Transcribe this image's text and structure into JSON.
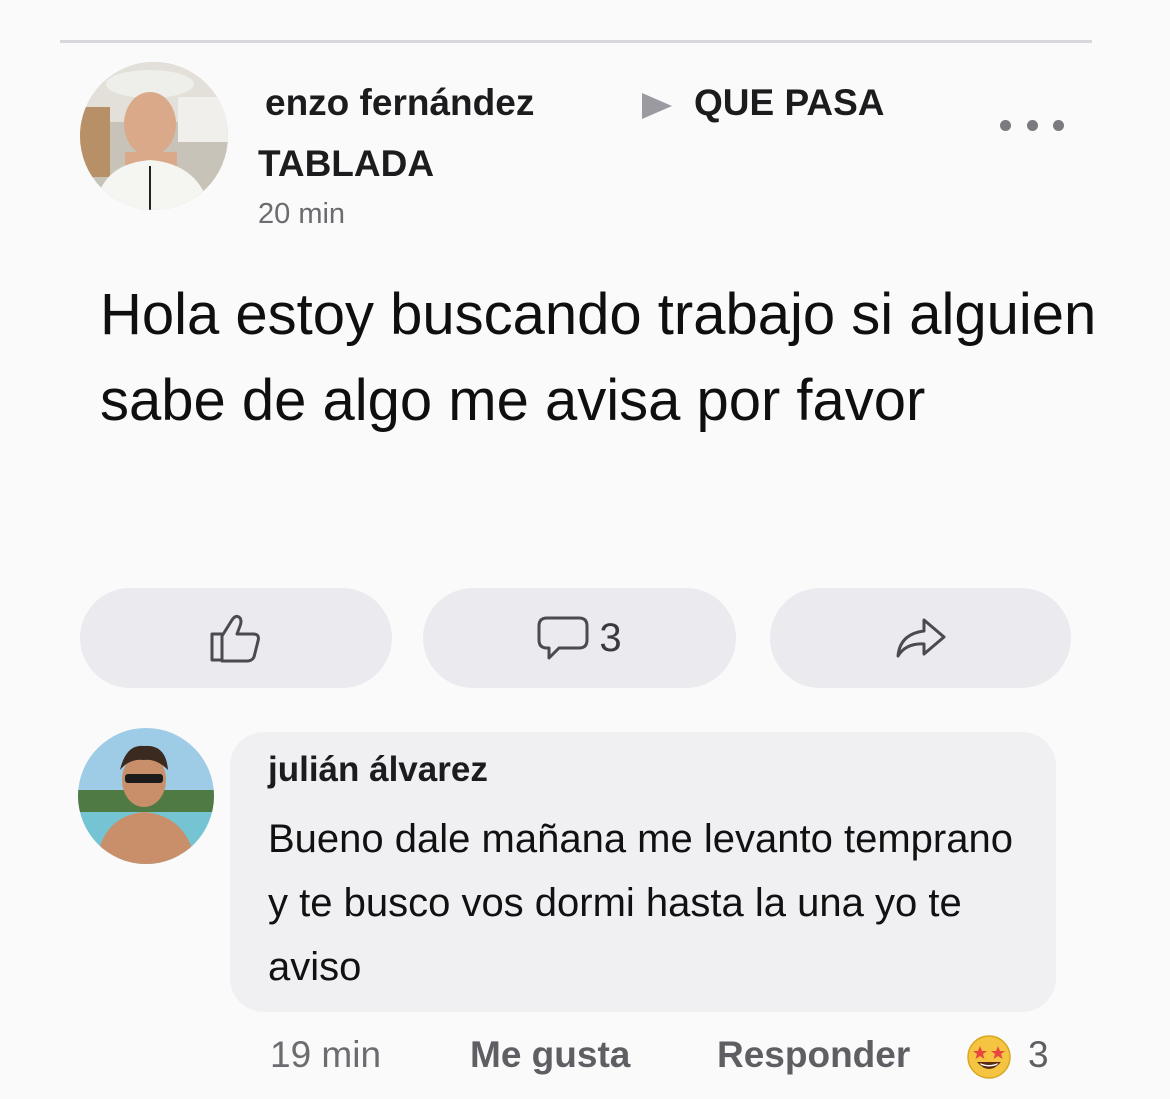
{
  "post": {
    "author": "enzo fernández",
    "group_line_1": "QUE PASA",
    "group_line_2": "TABLADA",
    "time": "20 min",
    "text": "Hola estoy buscando trabajo si alguien sabe de algo me avisa por favor",
    "comment_count": "3"
  },
  "comment": {
    "author": "julián álvarez",
    "text": "Bueno dale mañana me levanto temprano y te busco vos dormi hasta la una yo te aviso",
    "time": "19 min",
    "like_label": "Me gusta",
    "reply_label": "Responder",
    "reaction_count": "3"
  },
  "icons": {
    "more": "more-horizontal-icon",
    "like": "thumbs-up-icon",
    "comment": "comment-bubble-icon",
    "share": "share-arrow-icon",
    "reaction": "star-struck-emoji-icon",
    "group_arrow": "triangle-right-icon"
  }
}
